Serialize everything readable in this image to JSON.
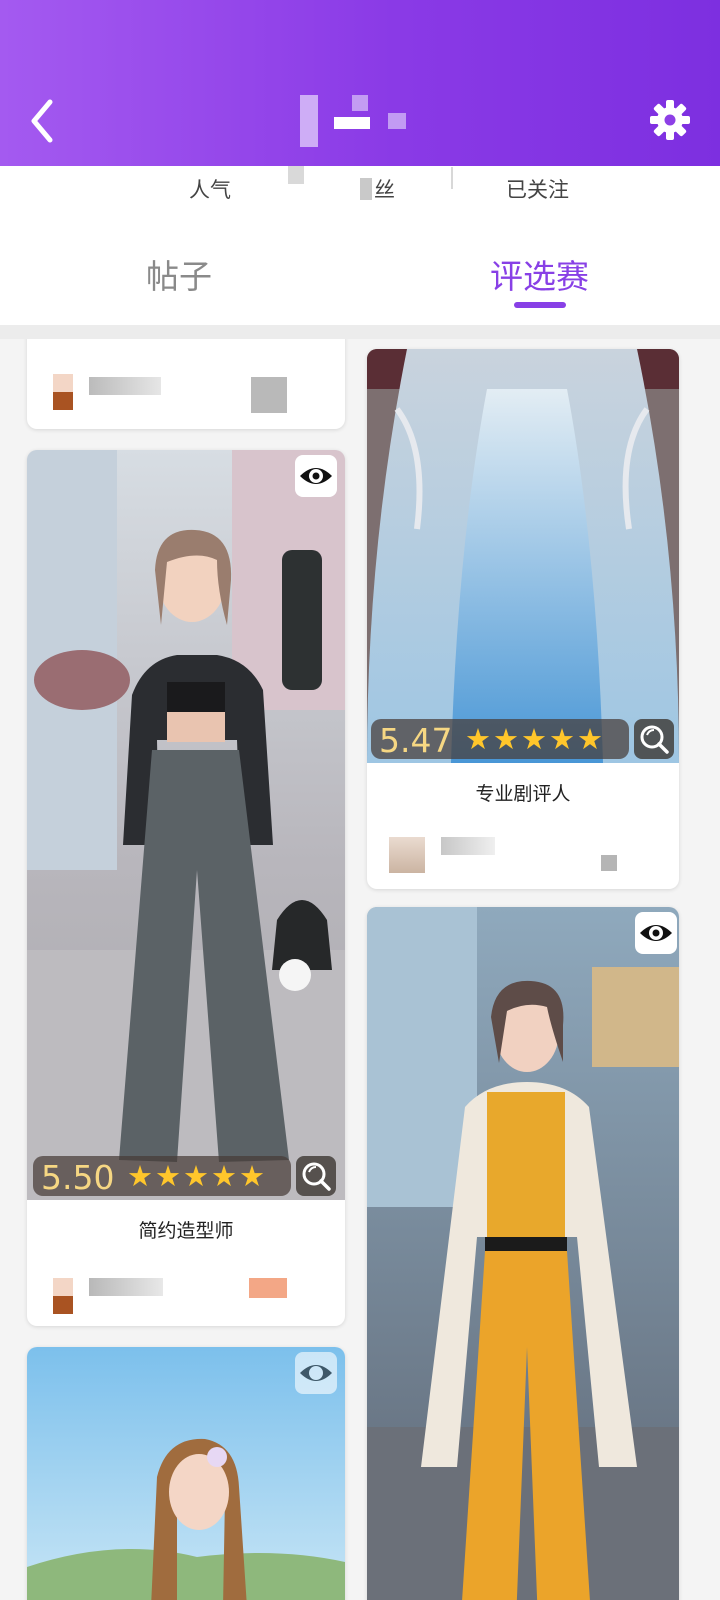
{
  "header": {
    "back_icon": "chevron-left-icon",
    "settings_icon": "gear-icon"
  },
  "stats": {
    "popularity_label": "人气",
    "fans_label": "丝",
    "following_label": "已关注"
  },
  "tabs": [
    {
      "label": "帖子",
      "active": false
    },
    {
      "label": "评选赛",
      "active": true
    }
  ],
  "colors": {
    "header_start": "#a45af0",
    "header_end": "#7d2fe0",
    "accent": "#8840e6",
    "star": "#ffc62b",
    "rating_text": "#f6d783"
  },
  "cards": [
    {
      "rating": "5.50",
      "stars": "★★★★★",
      "caption": "简约造型师",
      "icons": [
        "eye-icon",
        "zoom-icon"
      ]
    },
    {
      "rating": "5.47",
      "stars": "★★★★★",
      "caption": "专业剧评人",
      "icons": [
        "zoom-icon"
      ]
    },
    {
      "icons": [
        "eye-icon"
      ]
    }
  ]
}
